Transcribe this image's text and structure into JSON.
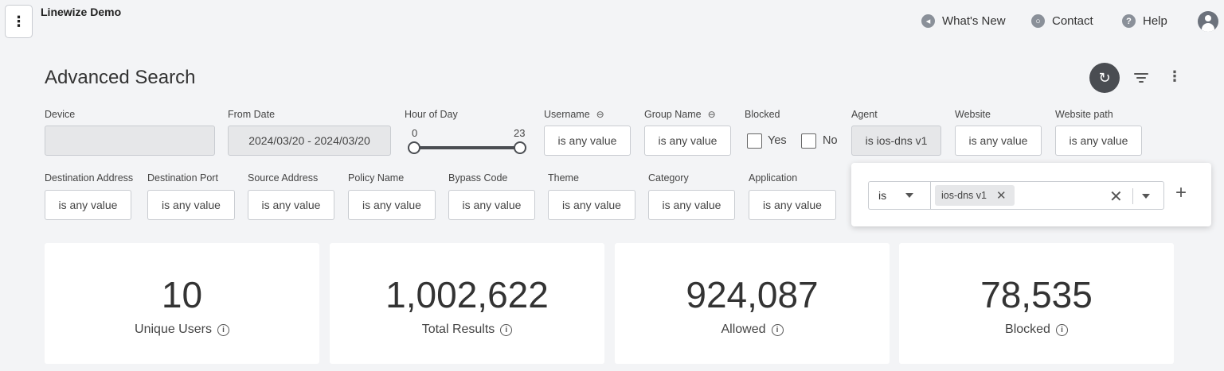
{
  "header": {
    "org_name": "Linewize Demo",
    "links": [
      {
        "label": "What's New",
        "icon": "megaphone-icon"
      },
      {
        "label": "Contact",
        "icon": "chat-icon"
      },
      {
        "label": "Help",
        "icon": "help-icon"
      }
    ]
  },
  "page": {
    "title": "Advanced Search"
  },
  "filters": {
    "device": {
      "label": "Device",
      "value": ""
    },
    "from_date": {
      "label": "From Date",
      "value": "2024/03/20 - 2024/03/20"
    },
    "hour_of_day": {
      "label": "Hour of Day",
      "min": "0",
      "max": "23"
    },
    "username": {
      "label": "Username",
      "value": "is any value"
    },
    "group_name": {
      "label": "Group Name",
      "value": "is any value"
    },
    "blocked": {
      "label": "Blocked",
      "yes_label": "Yes",
      "no_label": "No",
      "yes_checked": false,
      "no_checked": false
    },
    "agent": {
      "label": "Agent",
      "value": "is ios-dns v1"
    },
    "website": {
      "label": "Website",
      "value": "is any value"
    },
    "website_path": {
      "label": "Website path",
      "value": "is any value"
    },
    "destination_address": {
      "label": "Destination Address",
      "value": "is any value"
    },
    "destination_port": {
      "label": "Destination Port",
      "value": "is any value"
    },
    "source_address": {
      "label": "Source Address",
      "value": "is any value"
    },
    "policy_name": {
      "label": "Policy Name",
      "value": "is any value"
    },
    "bypass_code": {
      "label": "Bypass Code",
      "value": "is any value"
    },
    "theme": {
      "label": "Theme",
      "value": "is any value"
    },
    "category": {
      "label": "Category",
      "value": "is any value"
    },
    "application": {
      "label": "Application",
      "value": "is any value"
    }
  },
  "agent_popover": {
    "operator": "is",
    "chip": "ios-dns v1"
  },
  "stats": [
    {
      "value": "10",
      "label": "Unique Users"
    },
    {
      "value": "1,002,622",
      "label": "Total Results"
    },
    {
      "value": "924,087",
      "label": "Allowed"
    },
    {
      "value": "78,535",
      "label": "Blocked"
    }
  ]
}
